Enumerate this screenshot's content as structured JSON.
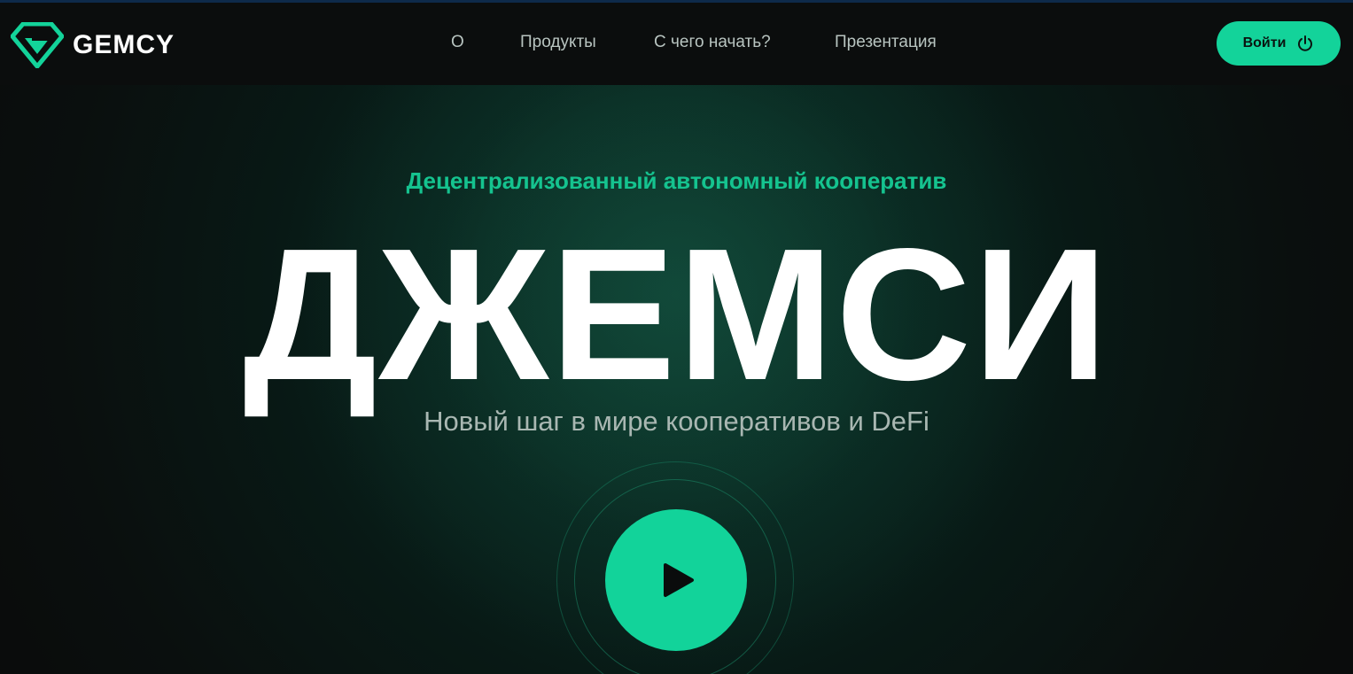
{
  "header": {
    "logo_text": "GEMCY",
    "nav": [
      "О",
      "Продукты",
      "С чего начать?",
      "Презентация"
    ],
    "login_label": "Войти"
  },
  "hero": {
    "subtitle": "Децентрализованный автономный кооператив",
    "title": "ДЖЕМСИ",
    "tagline": "Новый шаг в мире кооперативов и DeFi"
  },
  "icons": {
    "logo": "gem-logo-icon",
    "login": "power-icon",
    "video": "play-icon"
  },
  "colors": {
    "accent": "#13d39a",
    "background": "#0a0c0c",
    "subtitle": "#15c38f"
  }
}
